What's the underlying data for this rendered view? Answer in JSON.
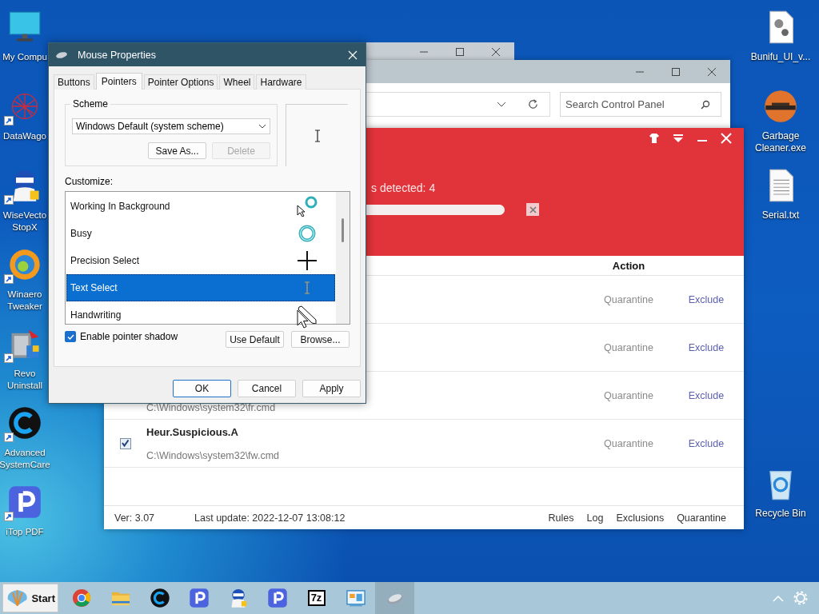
{
  "desktop": {
    "left_icons": [
      {
        "label": "My Compu",
        "kind": "monitor",
        "shortcut": false
      },
      {
        "label": "DataWago",
        "kind": "network",
        "shortcut": true
      },
      {
        "label": "WiseVecto\nStopX",
        "kind": "robot",
        "shortcut": true
      },
      {
        "label": "Winaero\nTweaker",
        "kind": "swirl",
        "shortcut": true
      },
      {
        "label": "Revo\nUninstall",
        "kind": "installer",
        "shortcut": true
      },
      {
        "label": "Advanced\nSystemCare",
        "kind": "c-circle",
        "shortcut": true
      },
      {
        "label": "iTop PDF",
        "kind": "p-tile",
        "shortcut": true
      }
    ],
    "right_icons": [
      {
        "label": "Bunifu_UI_v...",
        "kind": "doc-gear",
        "shortcut": false
      },
      {
        "label": "Garbage\nCleaner.exe",
        "kind": "orange-circle",
        "shortcut": false
      },
      {
        "label": "Serial.txt",
        "kind": "text-file",
        "shortcut": false
      },
      {
        "label": "Recycle Bin",
        "kind": "recycle",
        "shortcut": false
      }
    ]
  },
  "control_panel": {
    "search": {
      "placeholder": "Search Control Panel"
    }
  },
  "scanner": {
    "status": "s detected: 4",
    "progress": {
      "level": 1
    },
    "header": "Action",
    "rows": [
      {
        "quarantine": "Quarantine",
        "exclude": "Exclude"
      },
      {
        "quarantine": "Quarantine",
        "exclude": "Exclude"
      },
      {
        "path": "C:\\Windows\\system32\\fr.cmd",
        "quarantine": "Quarantine",
        "exclude": "Exclude"
      },
      {
        "checked": true,
        "name": "Heur.Suspicious.A",
        "path": "C:\\Windows\\system32\\fw.cmd",
        "quarantine": "Quarantine",
        "exclude": "Exclude"
      }
    ],
    "footer": {
      "version": "Ver: 3.07",
      "last_update": "Last update: 2022-12-07 13:08:12",
      "links": [
        "Rules",
        "Log",
        "Exclusions",
        "Quarantine"
      ]
    }
  },
  "dialog": {
    "title": "Mouse Properties",
    "tabs": [
      {
        "label": "Buttons",
        "selected": false
      },
      {
        "label": "Pointers",
        "selected": true
      },
      {
        "label": "Pointer Options",
        "selected": false
      },
      {
        "label": "Wheel",
        "selected": false
      },
      {
        "label": "Hardware",
        "selected": false
      }
    ],
    "scheme": {
      "label": "Scheme",
      "value": "Windows Default (system scheme)",
      "buttons": [
        {
          "label": "Save As...",
          "disabled": false
        },
        {
          "label": "Delete",
          "disabled": true
        }
      ]
    },
    "customize_label": "Customize:",
    "pointers": [
      {
        "label": "Working In Background",
        "kind": "working",
        "selected": false
      },
      {
        "label": "Busy",
        "kind": "busy",
        "selected": false
      },
      {
        "label": "Precision Select",
        "kind": "cross",
        "selected": false
      },
      {
        "label": "Text Select",
        "kind": "beam",
        "selected": true
      },
      {
        "label": "Handwriting",
        "kind": "pen",
        "selected": false
      }
    ],
    "shadow": {
      "label": "Enable pointer shadow",
      "checked": true
    },
    "list_buttons": [
      "Use Default",
      "Browse..."
    ],
    "buttons": [
      {
        "label": "OK",
        "default": true
      },
      {
        "label": "Cancel",
        "default": false
      },
      {
        "label": "Apply",
        "default": false
      }
    ]
  },
  "taskbar": {
    "start": "Start",
    "items": [
      {
        "kind": "chrome",
        "selected": false
      },
      {
        "kind": "folder",
        "selected": false
      },
      {
        "kind": "c-circle",
        "selected": false
      },
      {
        "kind": "p-tile",
        "selected": false
      },
      {
        "kind": "robot",
        "selected": false
      },
      {
        "kind": "p-tile",
        "selected": false
      },
      {
        "kind": "archive",
        "text": "7z",
        "selected": false
      },
      {
        "kind": "monitor-app",
        "selected": false
      },
      {
        "kind": "mouse",
        "selected": true
      }
    ]
  }
}
